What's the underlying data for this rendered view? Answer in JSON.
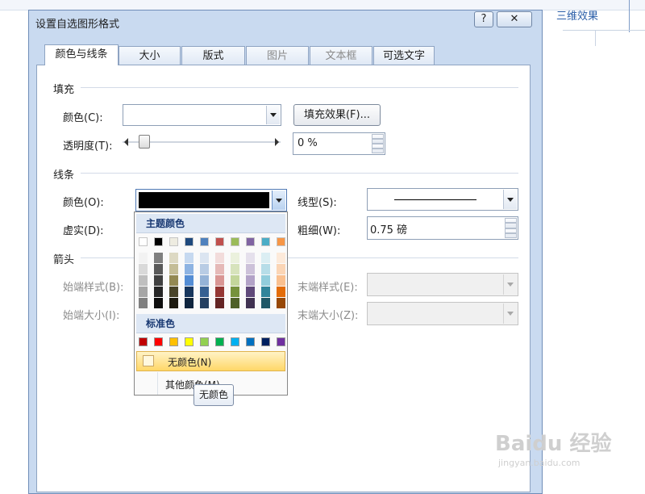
{
  "background_app": {
    "tab_label": "三维效果"
  },
  "dialog": {
    "title": "设置自选图形格式",
    "help_label": "?",
    "close_label": "✕",
    "tabs": [
      {
        "label": "颜色与线条",
        "active": true,
        "enabled": true
      },
      {
        "label": "大小",
        "active": false,
        "enabled": true
      },
      {
        "label": "版式",
        "active": false,
        "enabled": true
      },
      {
        "label": "图片",
        "active": false,
        "enabled": false
      },
      {
        "label": "文本框",
        "active": false,
        "enabled": false
      },
      {
        "label": "可选文字",
        "active": false,
        "enabled": true
      }
    ],
    "fill": {
      "section_label": "填充",
      "color_label": "颜色(C):",
      "color_value": "",
      "effects_button": "填充效果(F)...",
      "transparency_label": "透明度(T):",
      "transparency_value": "0 %",
      "transparency_fraction": 0
    },
    "line": {
      "section_label": "线条",
      "color_label": "颜色(O):",
      "color_value": "#000000",
      "style_label": "线型(S):",
      "dash_label": "虚实(D):",
      "weight_label": "粗细(W):",
      "weight_value": "0.75 磅"
    },
    "arrows": {
      "section_label": "箭头",
      "begin_style_label": "始端样式(B):",
      "end_style_label": "末端样式(E):",
      "begin_size_label": "始端大小(I):",
      "end_size_label": "末端大小(Z):"
    }
  },
  "color_popup": {
    "theme_header": "主题颜色",
    "theme_colors": [
      "#ffffff",
      "#000000",
      "#eeece1",
      "#1f497d",
      "#4f81bd",
      "#c0504d",
      "#9bbb59",
      "#8064a2",
      "#4bacc6",
      "#f79646"
    ],
    "shades": [
      [
        "#f2f2f2",
        "#d9d9d9",
        "#bfbfbf",
        "#a6a6a6",
        "#808080"
      ],
      [
        "#7f7f7f",
        "#595959",
        "#404040",
        "#262626",
        "#0d0d0d"
      ],
      [
        "#ddd9c3",
        "#c4bd97",
        "#938953",
        "#494429",
        "#1d1b10"
      ],
      [
        "#c6d9f0",
        "#8db3e2",
        "#548dd4",
        "#17365d",
        "#0f243e"
      ],
      [
        "#dbe5f1",
        "#b8cce4",
        "#95b3d7",
        "#366092",
        "#244061"
      ],
      [
        "#f2dcdb",
        "#e5b9b7",
        "#d99694",
        "#953734",
        "#632423"
      ],
      [
        "#ebf1dd",
        "#d7e3bc",
        "#c3d69b",
        "#76923c",
        "#4f6128"
      ],
      [
        "#e5e0ec",
        "#ccc1d9",
        "#b2a2c7",
        "#5f497a",
        "#3f3151"
      ],
      [
        "#dbeef3",
        "#b7dde8",
        "#92cddc",
        "#31859b",
        "#205867"
      ],
      [
        "#fdeada",
        "#fbd5b5",
        "#fac08f",
        "#e36c09",
        "#974806"
      ]
    ],
    "standard_header": "标准色",
    "standard_colors": [
      "#c00000",
      "#ff0000",
      "#ffc000",
      "#ffff00",
      "#92d050",
      "#00b050",
      "#00b0f0",
      "#0070c0",
      "#002060",
      "#7030a0"
    ],
    "no_color_label": "无颜色(N)",
    "more_colors_label": "其他颜色(M)...",
    "tooltip": "无颜色"
  },
  "watermark": {
    "logo": "Baidu 经验",
    "url": "jingyan.baidu.com"
  }
}
